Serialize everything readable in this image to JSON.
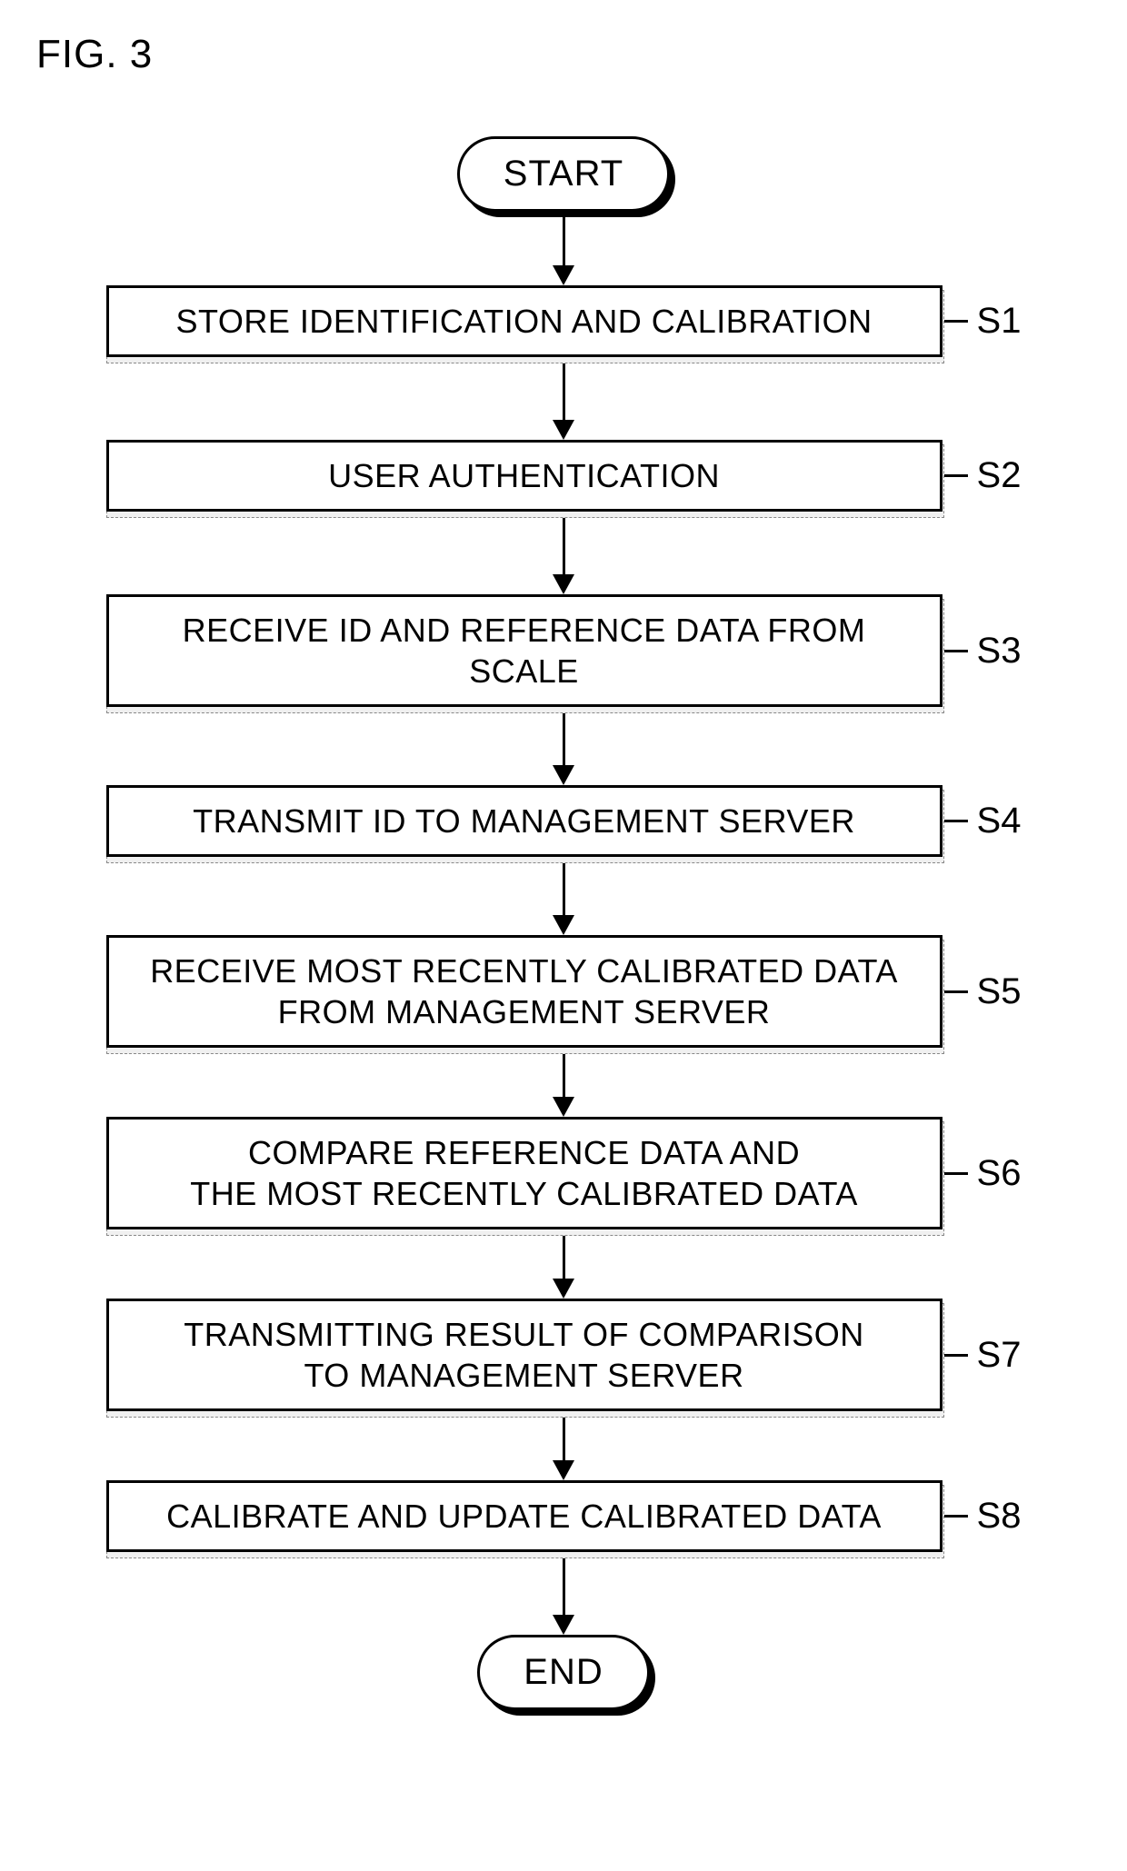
{
  "figure_title": "FIG. 3",
  "terminals": {
    "start": "START",
    "end": "END"
  },
  "steps": [
    {
      "id": "S1",
      "text": "STORE IDENTIFICATION AND CALIBRATION"
    },
    {
      "id": "S2",
      "text": "USER AUTHENTICATION"
    },
    {
      "id": "S3",
      "text": "RECEIVE ID AND REFERENCE DATA FROM SCALE"
    },
    {
      "id": "S4",
      "text": "TRANSMIT ID TO MANAGEMENT SERVER"
    },
    {
      "id": "S5",
      "text": "RECEIVE MOST RECENTLY CALIBRATED DATA\nFROM MANAGEMENT SERVER"
    },
    {
      "id": "S6",
      "text": "COMPARE REFERENCE DATA AND\nTHE MOST RECENTLY CALIBRATED DATA"
    },
    {
      "id": "S7",
      "text": "TRANSMITTING RESULT OF COMPARISON\nTO MANAGEMENT SERVER"
    },
    {
      "id": "S8",
      "text": "CALIBRATE AND UPDATE CALIBRATED DATA"
    }
  ]
}
